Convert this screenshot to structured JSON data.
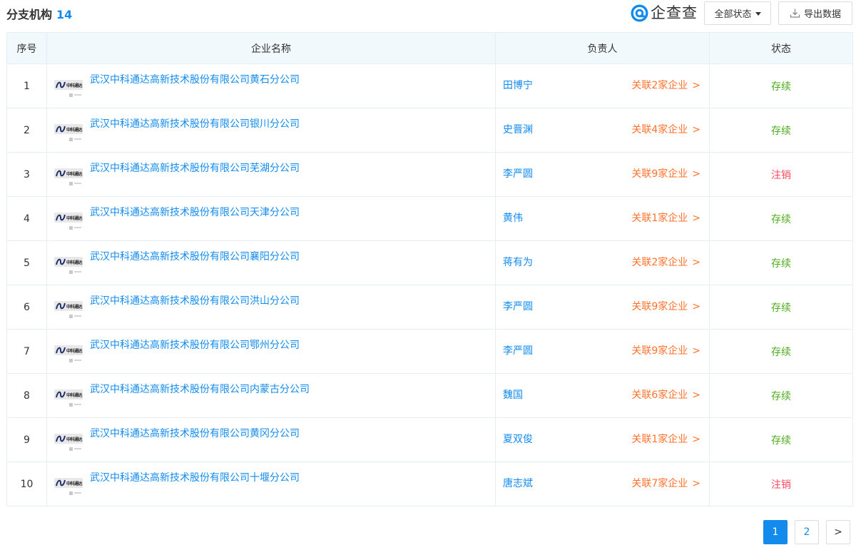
{
  "header": {
    "title": "分支机构",
    "count": "14",
    "brand_name": "企查查",
    "status_filter_label": "全部状态",
    "export_label": "导出数据"
  },
  "table": {
    "columns": [
      "序号",
      "企业名称",
      "负责人",
      "状态"
    ],
    "rows": [
      {
        "index": "1",
        "company": "武汉中科通达高新技术股份有限公司黄石分公司",
        "person": "田博宁",
        "related": "关联2家企业",
        "status": "存续"
      },
      {
        "index": "2",
        "company": "武汉中科通达高新技术股份有限公司银川分公司",
        "person": "史晋渊",
        "related": "关联4家企业",
        "status": "存续"
      },
      {
        "index": "3",
        "company": "武汉中科通达高新技术股份有限公司芜湖分公司",
        "person": "李严圆",
        "related": "关联9家企业",
        "status": "注销"
      },
      {
        "index": "4",
        "company": "武汉中科通达高新技术股份有限公司天津分公司",
        "person": "黄伟",
        "related": "关联1家企业",
        "status": "存续"
      },
      {
        "index": "5",
        "company": "武汉中科通达高新技术股份有限公司襄阳分公司",
        "person": "蒋有为",
        "related": "关联2家企业",
        "status": "存续"
      },
      {
        "index": "6",
        "company": "武汉中科通达高新技术股份有限公司洪山分公司",
        "person": "李严圆",
        "related": "关联9家企业",
        "status": "存续"
      },
      {
        "index": "7",
        "company": "武汉中科通达高新技术股份有限公司鄂州分公司",
        "person": "李严圆",
        "related": "关联9家企业",
        "status": "存续"
      },
      {
        "index": "8",
        "company": "武汉中科通达高新技术股份有限公司内蒙古分公司",
        "person": "魏国",
        "related": "关联6家企业",
        "status": "存续"
      },
      {
        "index": "9",
        "company": "武汉中科通达高新技术股份有限公司黄冈分公司",
        "person": "夏双俊",
        "related": "关联1家企业",
        "status": "存续"
      },
      {
        "index": "10",
        "company": "武汉中科通达高新技术股份有限公司十堰分公司",
        "person": "唐志斌",
        "related": "关联7家企业",
        "status": "注销"
      }
    ]
  },
  "logo_text": "中科通达",
  "related_arrow": ">",
  "status_colors": {
    "存续": "#4eab1e",
    "注销": "#fd485e"
  },
  "accent_color": "#128bed",
  "icons": {
    "brand": "qichacha-logo-icon",
    "export": "download-icon",
    "filter": "caret-down-icon",
    "next": "chevron-right-icon"
  },
  "pagination": {
    "pages": [
      "1",
      "2"
    ],
    "current": "1",
    "next_label": ">"
  }
}
